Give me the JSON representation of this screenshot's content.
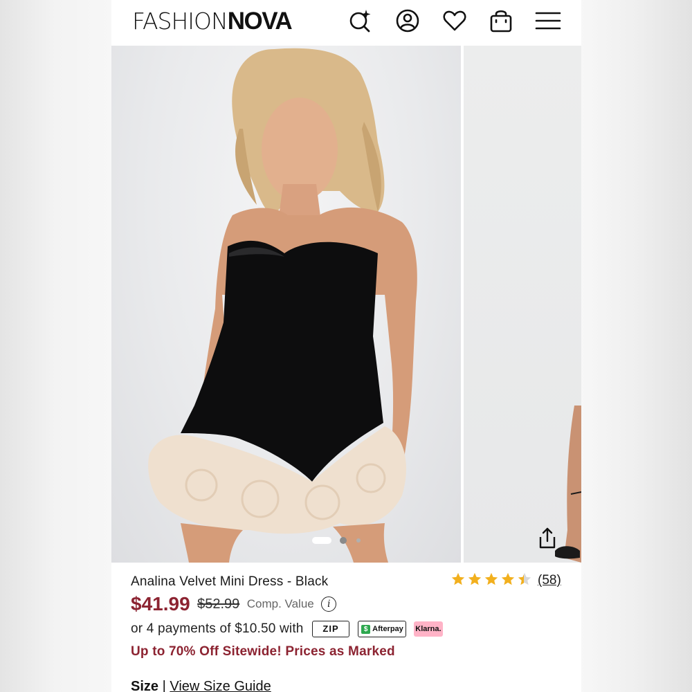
{
  "header": {
    "logo_thin": "FASHION",
    "logo_bold": "NOVA",
    "icons": [
      "ai-search-icon",
      "account-icon",
      "wishlist-heart-icon",
      "shopping-bag-icon",
      "menu-icon"
    ]
  },
  "gallery": {
    "image_count": 3,
    "active_index": 0,
    "share_icon": "share-icon"
  },
  "product": {
    "title": "Analina Velvet Mini Dress - Black",
    "rating": 4.5,
    "reviews": "(58)",
    "price": "$41.99",
    "original_price": "$52.99",
    "comp_label": "Comp. Value",
    "payments_text": "or 4 payments of $10.50  with",
    "pay_badges": {
      "zip": "ZIP",
      "afterpay": "Afterpay",
      "klarna": "Klarna."
    },
    "promo": "Up to 70% Off Sitewide! Prices as Marked",
    "size_label": "Size",
    "size_sep": " | ",
    "size_guide": "View Size Guide"
  },
  "colors": {
    "accent_red": "#8c2331",
    "star_gold": "#f2b01e",
    "klarna_pink": "#ffb3c7",
    "afterpay_green": "#2ea84f"
  }
}
